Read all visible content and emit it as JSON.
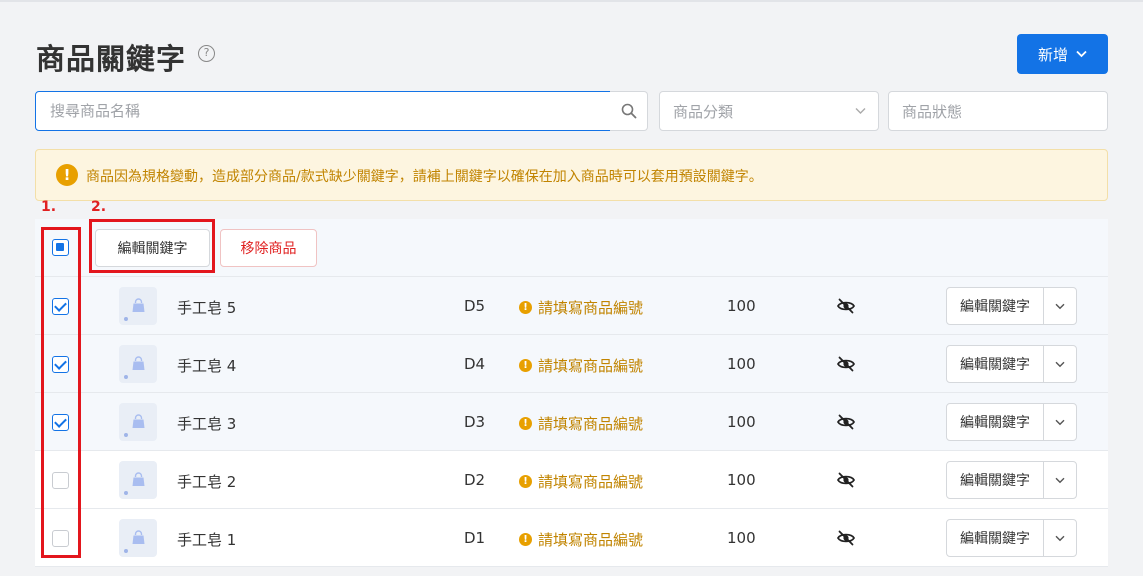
{
  "header": {
    "title": "商品關鍵字",
    "help_icon": "question-circle-icon",
    "new_button_label": "新增"
  },
  "filters": {
    "search_placeholder": "搜尋商品名稱",
    "category_placeholder": "商品分類",
    "status_placeholder": "商品狀態"
  },
  "alert": {
    "icon": "exclamation-circle-icon",
    "text": "商品因為規格變動，造成部分商品/款式缺少關鍵字，請補上關鍵字以確保在加入商品時可以套用預設關鍵字。"
  },
  "annotations": {
    "label_1": "1.",
    "label_2": "2."
  },
  "bulk_actions": {
    "edit_keywords_label": "編輯關鍵字",
    "remove_products_label": "移除商品",
    "select_all_state": "partial"
  },
  "rows": [
    {
      "checked": true,
      "name": "手工皂 5",
      "code": "D5",
      "warning": "請填寫商品編號",
      "qty": "100",
      "edit_label": "編輯關鍵字"
    },
    {
      "checked": true,
      "name": "手工皂 4",
      "code": "D4",
      "warning": "請填寫商品編號",
      "qty": "100",
      "edit_label": "編輯關鍵字"
    },
    {
      "checked": true,
      "name": "手工皂 3",
      "code": "D3",
      "warning": "請填寫商品編號",
      "qty": "100",
      "edit_label": "編輯關鍵字"
    },
    {
      "checked": false,
      "name": "手工皂 2",
      "code": "D2",
      "warning": "請填寫商品編號",
      "qty": "100",
      "edit_label": "編輯關鍵字"
    },
    {
      "checked": false,
      "name": "手工皂 1",
      "code": "D1",
      "warning": "請填寫商品編號",
      "qty": "100",
      "edit_label": "編輯關鍵字"
    }
  ],
  "colors": {
    "primary": "#1373e6",
    "warning": "#e8a000",
    "danger": "#e02020",
    "annotation": "#e3161d"
  }
}
